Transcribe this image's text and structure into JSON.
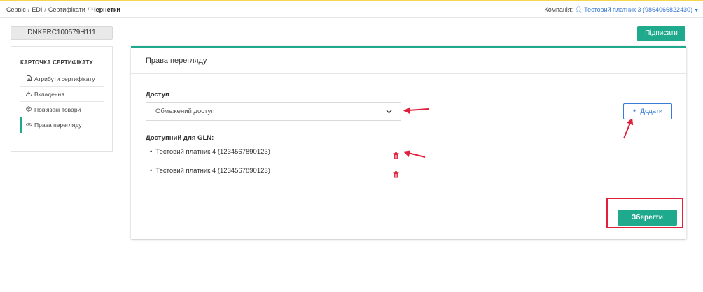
{
  "breadcrumb": {
    "items": [
      "Сервіс",
      "EDI",
      "Сертифікати"
    ],
    "current": "Чернетки",
    "separator": "/"
  },
  "company": {
    "label": "Компанія:",
    "value": "Тестовий платник 3 (9864066822430)",
    "icon": "user-icon"
  },
  "document": {
    "id": "DNKFRC100579H111"
  },
  "toolbar": {
    "sign_label": "Підписати"
  },
  "sidebar": {
    "title": "КАРТОЧКА СЕРТИФІКАТУ",
    "items": [
      {
        "label": "Атрибути сертифікату",
        "icon": "document-icon",
        "active": false
      },
      {
        "label": "Вкладення",
        "icon": "download-icon",
        "active": false
      },
      {
        "label": "Пов'язані товари",
        "icon": "box-icon",
        "active": false
      },
      {
        "label": "Права перегляду",
        "icon": "eye-icon",
        "active": true
      }
    ]
  },
  "panel": {
    "title": "Права перегляду",
    "access_label": "Доступ",
    "access_value": "Обмежений доступ",
    "add_label": "Додати",
    "gln_label": "Доступний для GLN:",
    "gln_items": [
      "Тестовий платник 4 (1234567890123)",
      "Тестовий платник 4 (1234567890123)"
    ],
    "save_label": "Зберегти"
  },
  "colors": {
    "accent": "#1fa98d",
    "link": "#3a7bd5",
    "annotation": "#e0203c",
    "topbar_stripe": "#f3d652"
  }
}
